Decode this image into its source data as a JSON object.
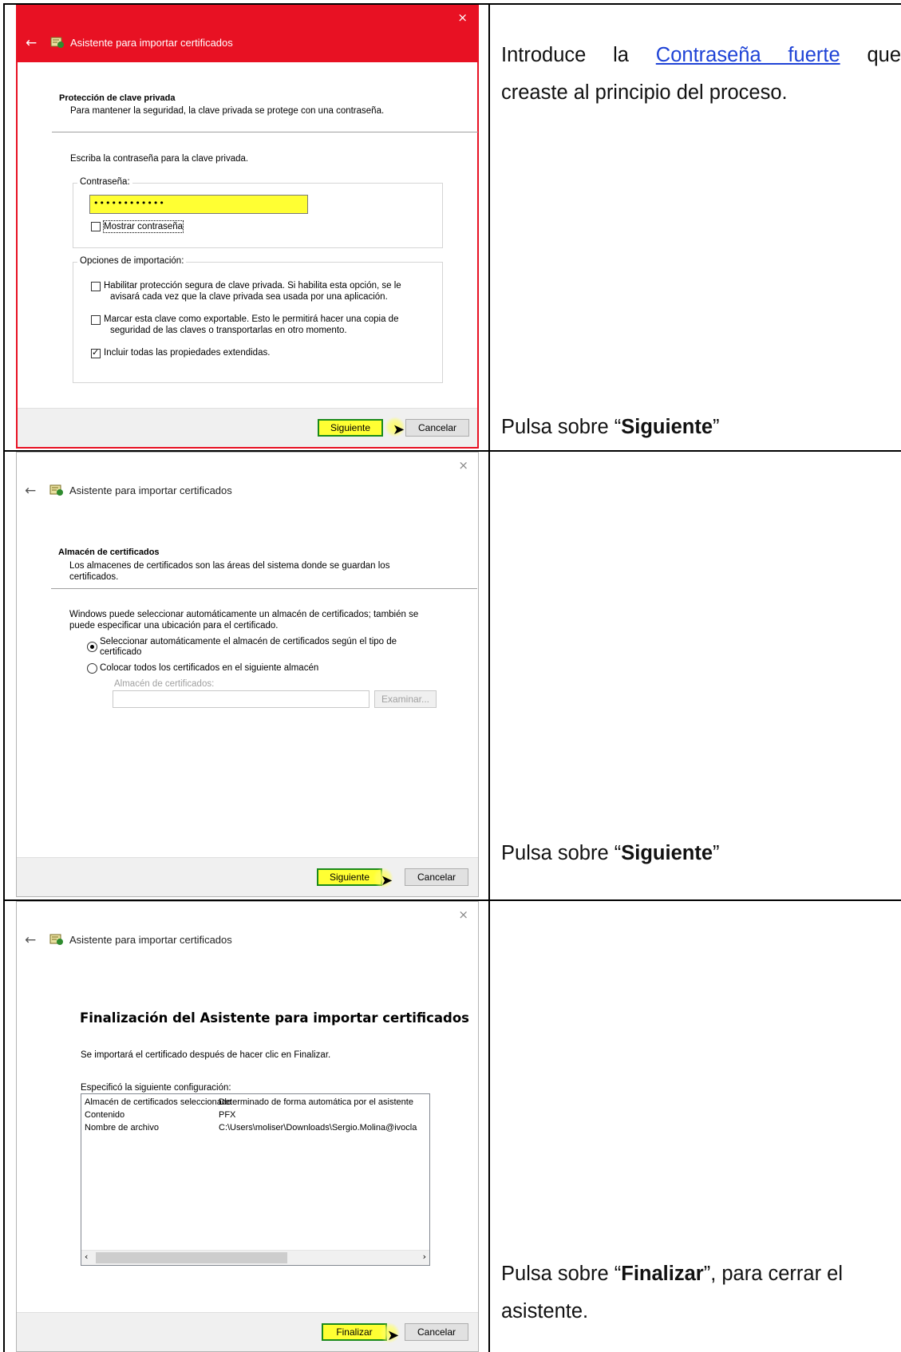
{
  "rows": [
    {
      "dialog": {
        "title": "Asistente para importar certificados",
        "close": "×",
        "back": "←",
        "section_title": "Protección de clave privada",
        "section_sub": "Para mantener la seguridad, la clave privada se protege con una contraseña.",
        "prompt": "Escriba la contraseña para la clave privada.",
        "password_group": "Contraseña:",
        "password_value": "••••••••••••",
        "show_password": "Mostrar contraseña",
        "options_group": "Opciones de importación:",
        "opt1_line1": "Habilitar protección segura de clave privada. Si habilita esta opción, se le",
        "opt1_line2": "avisará cada vez que la clave privada sea usada por una aplicación.",
        "opt2_line1": "Marcar esta clave como exportable. Esto le permitirá hacer una copia de",
        "opt2_line2": "seguridad de las claves o transportarlas en otro momento.",
        "opt3": "Incluir todas las propiedades extendidas.",
        "next": "Siguiente",
        "cancel": "Cancelar"
      },
      "instruction_top_pre": "Introduce la ",
      "instruction_top_link": "Contraseña fuerte",
      "instruction_top_post": " que",
      "instruction_top_line2": "creaste al principio del proceso.",
      "instruction_bottom_pre": "Pulsa sobre “",
      "instruction_bottom_bold": "Siguiente",
      "instruction_bottom_post": "”"
    },
    {
      "dialog": {
        "title": "Asistente para importar certificados",
        "close": "×",
        "back": "←",
        "section_title": "Almacén de certificados",
        "section_sub_line1": "Los almacenes de certificados son las áreas del sistema donde se guardan los",
        "section_sub_line2": "certificados.",
        "body_line1": "Windows puede seleccionar automáticamente un almacén de certificados; también se",
        "body_line2": "puede especificar una ubicación para el certificado.",
        "radio1_line1": "Seleccionar automáticamente el almacén de certificados según el tipo de",
        "radio1_line2": "certificado",
        "radio2": "Colocar todos los certificados en el siguiente almacén",
        "store_label": "Almacén de certificados:",
        "browse": "Examinar...",
        "next": "Siguiente",
        "cancel": "Cancelar"
      },
      "instruction_bottom_pre": "Pulsa sobre “",
      "instruction_bottom_bold": "Siguiente",
      "instruction_bottom_post": "”"
    },
    {
      "dialog": {
        "title": "Asistente para importar certificados",
        "close": "×",
        "back": "←",
        "heading": "Finalización del Asistente para importar certificados",
        "body": "Se importará el certificado después de hacer clic en Finalizar.",
        "config_label": "Especificó la siguiente configuración:",
        "list": [
          {
            "k": "Almacén de certificados seleccionado",
            "v": "Determinado de forma automática por el asistente"
          },
          {
            "k": "Contenido",
            "v": "PFX"
          },
          {
            "k": "Nombre de archivo",
            "v": "C:\\Users\\moliser\\Downloads\\Sergio.Molina@ivocla"
          }
        ],
        "scroll_left": "‹",
        "scroll_right": "›",
        "finish": "Finalizar",
        "cancel": "Cancelar"
      },
      "instruction_bottom_pre": "Pulsa sobre “",
      "instruction_bottom_bold": "Finalizar",
      "instruction_bottom_post": "”, para cerrar el",
      "instruction_bottom_line2": "asistente."
    }
  ]
}
